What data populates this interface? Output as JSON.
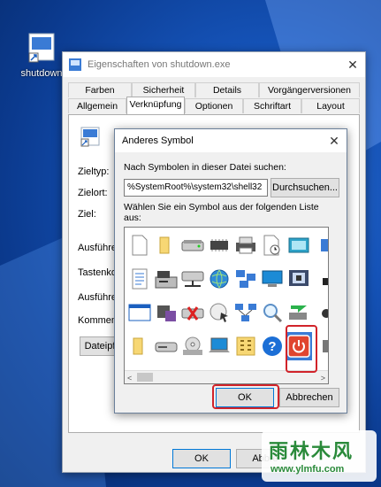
{
  "desktop": {
    "icon_label": "shutdown"
  },
  "window": {
    "title": "Eigenschaften von shutdown.exe",
    "close_glyph": "✕",
    "tabs_row1": [
      "Farben",
      "Sicherheit",
      "Details",
      "Vorgängerversionen"
    ],
    "tabs_row2": [
      "Allgemein",
      "Verknüpfung",
      "Optionen",
      "Schriftart",
      "Layout"
    ],
    "active_tab": "Verknüpfung",
    "fields": [
      "Zieltyp:",
      "Zielort:",
      "Ziel:",
      "Ausführen",
      "Tastenkon",
      "Ausführen",
      "Kommenta"
    ],
    "dateipfad_button": "Dateipf",
    "ok_label": "OK",
    "cancel_label": "Abbre"
  },
  "dialog": {
    "title": "Anderes Symbol",
    "close_glyph": "✕",
    "search_label": "Nach Symbolen in dieser Datei suchen:",
    "path_value": "%SystemRoot%\\system32\\shell32",
    "browse_label": "Durchsuchen...",
    "choose_label_1": "Wählen Sie ein Symbol aus der folgenden Liste",
    "choose_label_2": "aus:",
    "ok_label": "OK",
    "cancel_label": "Abbrechen",
    "scroll_left": "<",
    "scroll_right": ">",
    "selected_icon": "power-icon"
  },
  "watermark": {
    "line1": "雨林木风",
    "line2": "www.ylmfu.com"
  }
}
